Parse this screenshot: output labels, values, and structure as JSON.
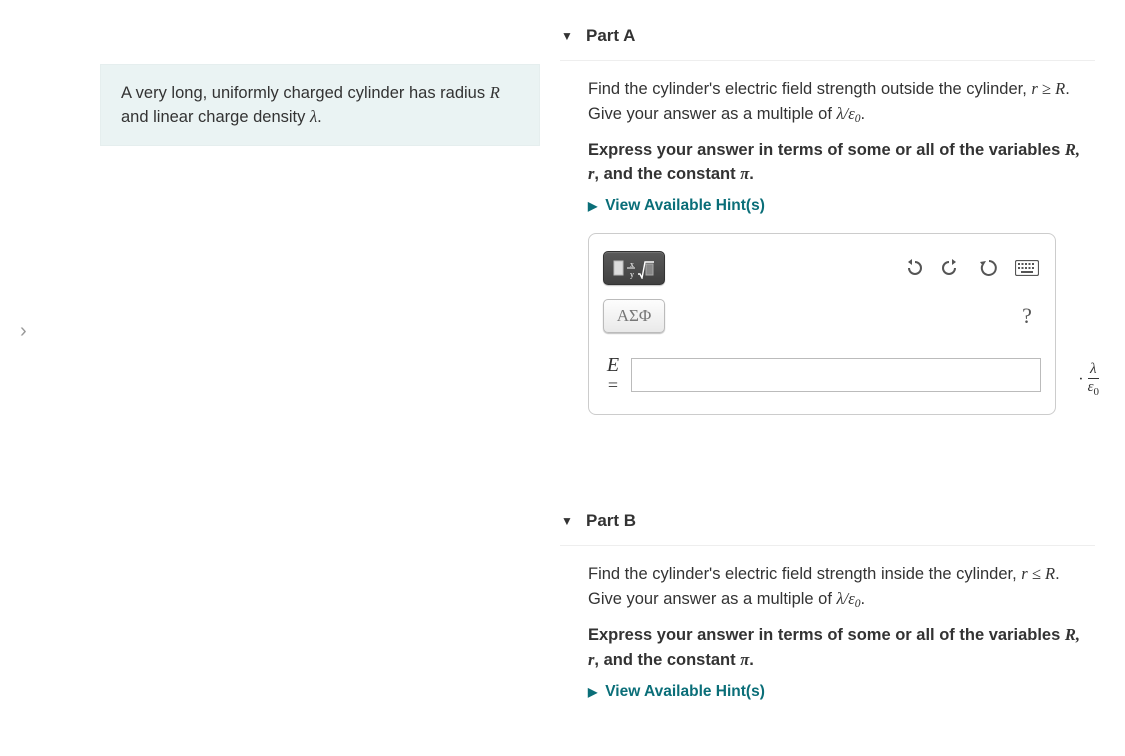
{
  "nav": {
    "collapse_icon": "›"
  },
  "problem": {
    "text_pre": "A very long, uniformly charged cylinder has radius ",
    "R": "R",
    "text_mid": " and linear charge density ",
    "lambda": "λ",
    "period": "."
  },
  "partA": {
    "title": "Part A",
    "q1_pre": "Find the cylinder's electric field strength outside the cylinder, ",
    "q1_rel": "r ≥ R",
    "q1_post": ". Give your answer as a multiple of ",
    "q1_mult": "λ/ε",
    "q1_mult_sub": "0",
    "q1_end": ".",
    "q2_pre": "Express your answer in terms of some or all of the variables ",
    "q2_vars": "R, r",
    "q2_mid": ", and the constant ",
    "q2_pi": "π",
    "q2_end": ".",
    "hint": "View Available Hint(s)",
    "toolbar": {
      "greek_label": "ΑΣΦ",
      "help_label": "?"
    },
    "eq_var": "E",
    "eq_sign": "=",
    "suffix_dot": "·",
    "suffix_num": "λ",
    "suffix_den": "ε",
    "suffix_den_sub": "0"
  },
  "partB": {
    "title": "Part B",
    "q1_pre": "Find the cylinder's electric field strength inside the cylinder, ",
    "q1_rel": "r ≤ R",
    "q1_post": ". Give your answer as a multiple of ",
    "q1_mult": "λ/ε",
    "q1_mult_sub": "0",
    "q1_end": ".",
    "q2_pre": "Express your answer in terms of some or all of the variables ",
    "q2_vars": "R, r",
    "q2_mid": ", and the constant ",
    "q2_pi": "π",
    "q2_end": ".",
    "hint": "View Available Hint(s)"
  }
}
